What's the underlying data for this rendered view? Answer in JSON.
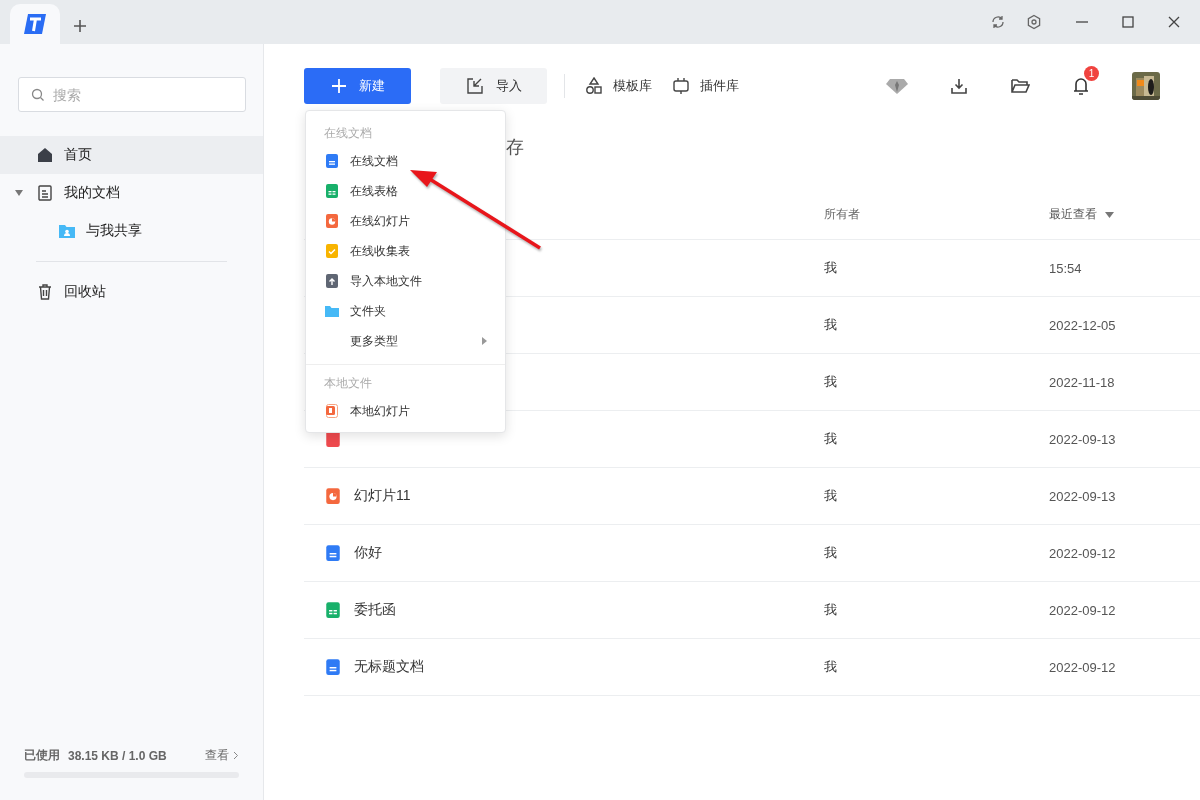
{
  "sidebar": {
    "search": {
      "placeholder": "搜索"
    },
    "nav": [
      {
        "label": "首页",
        "kind": "home",
        "selected": true
      },
      {
        "label": "我的文档",
        "kind": "document",
        "selected": false,
        "expanded": true,
        "children": [
          {
            "label": "与我共享",
            "kind": "shared",
            "selected": false
          }
        ]
      },
      {
        "label": "回收站",
        "kind": "trash",
        "selected": false
      }
    ],
    "storage": {
      "label": "已使用",
      "usage": "38.15 KB / 1.0 GB",
      "link": "查看",
      "level": 0
    }
  },
  "toolbar": {
    "new_button": "新建",
    "import_button": "导入",
    "links": [
      {
        "label": "模板库",
        "kind": "shapes"
      },
      {
        "label": "插件库",
        "kind": "plugin"
      }
    ],
    "notification_badge": "1"
  },
  "heading": "存",
  "table": {
    "columns": [
      {
        "label": "所有者",
        "sorted": false
      },
      {
        "label": "最近查看",
        "sorted": true
      }
    ],
    "rows": [
      {
        "owner": "我",
        "viewed": "15:54"
      },
      {
        "owner": "我",
        "viewed": "2022-12-05"
      },
      {
        "owner": "我",
        "viewed": "2022-11-18"
      },
      {
        "kind": "pdf",
        "owner": "我",
        "viewed": "2022-09-13"
      },
      {
        "kind": "slides",
        "name": "幻灯片11",
        "owner": "我",
        "viewed": "2022-09-13"
      },
      {
        "kind": "doc",
        "name": "你好",
        "owner": "我",
        "viewed": "2022-09-12"
      },
      {
        "kind": "sheet",
        "name": "委托函",
        "owner": "我",
        "viewed": "2022-09-12"
      },
      {
        "kind": "doc",
        "name": "无标题文档",
        "owner": "我",
        "viewed": "2022-09-12"
      }
    ]
  },
  "new_menu": {
    "sections": [
      {
        "title": "在线文档",
        "items": [
          {
            "kind": "doc",
            "label": "在线文档"
          },
          {
            "kind": "sheet",
            "label": "在线表格"
          },
          {
            "kind": "slides",
            "label": "在线幻灯片"
          },
          {
            "kind": "form",
            "label": "在线收集表"
          },
          {
            "kind": "upload",
            "label": "导入本地文件"
          },
          {
            "kind": "folder",
            "label": "文件夹"
          },
          {
            "kind": "more",
            "label": "更多类型"
          }
        ]
      },
      {
        "title": "本地文件",
        "items": [
          {
            "kind": "ppt",
            "label": "本地幻灯片"
          }
        ]
      }
    ]
  },
  "annotation": {
    "kind": "arrow"
  }
}
